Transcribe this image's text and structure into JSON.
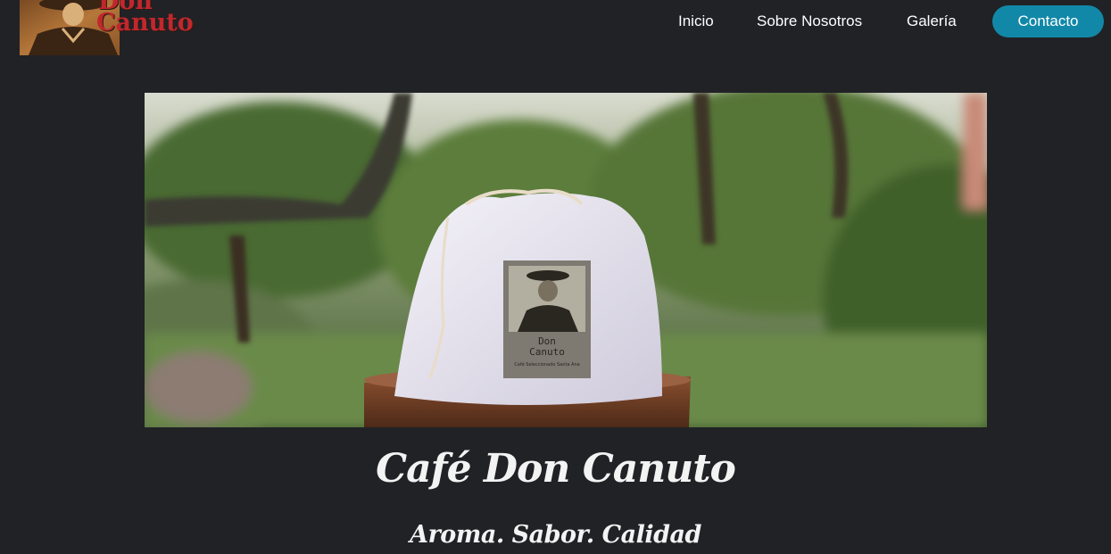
{
  "brand": {
    "logo_line1": "Don",
    "logo_line2": "Canuto"
  },
  "nav": {
    "items": [
      {
        "label": "Inicio"
      },
      {
        "label": "Sobre Nosotros"
      },
      {
        "label": "Galería"
      }
    ],
    "contact_label": "Contacto"
  },
  "hero": {
    "bag_label_line1": "Don",
    "bag_label_line2": "Canuto",
    "bag_label_small": "Café Seleccionado Santa Ana"
  },
  "main": {
    "title": "Café Don Canuto",
    "subtitle": "Aroma. Sabor. Calidad"
  },
  "colors": {
    "background": "#212226",
    "accent": "#1288a8",
    "logo_red": "#c1272d",
    "text": "#ffffff"
  }
}
